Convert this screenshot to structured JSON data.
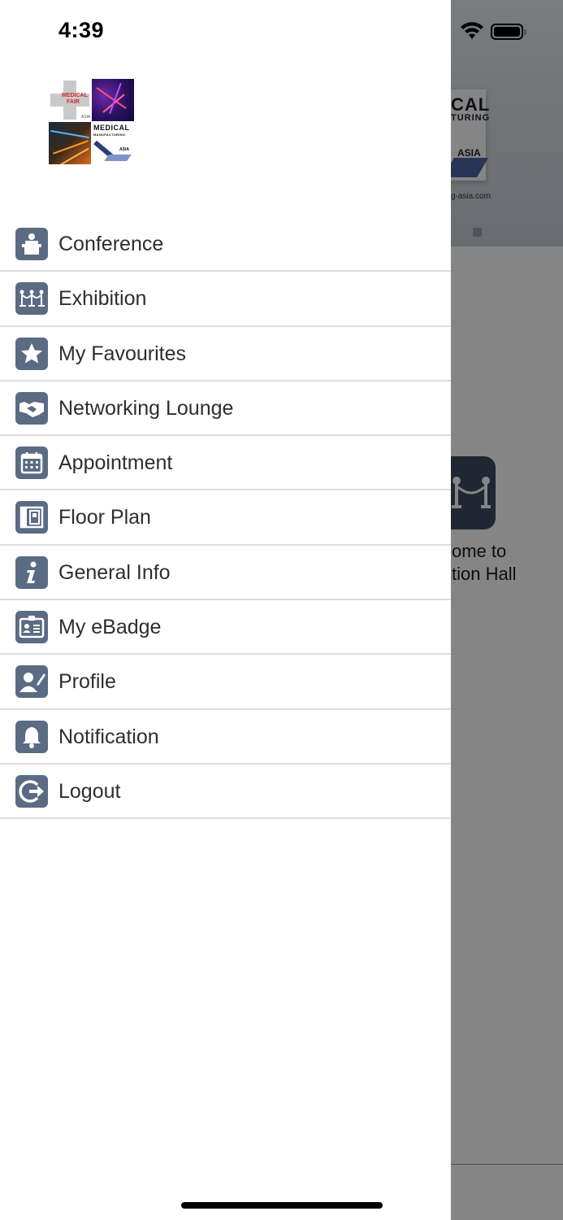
{
  "status_bar": {
    "time": "4:39"
  },
  "background": {
    "logo_line1": "CAL",
    "logo_line2": "TURING",
    "logo_asia": "ASIA",
    "url_fragment": "g-asia.com",
    "welcome_line1": "ome to",
    "welcome_line2": "tion Hall"
  },
  "drawer": {
    "logo": {
      "medical_fair_line1": "MEDICAL",
      "medical_fair_line2": "FAIR",
      "medical_fair_asia": "ASIA",
      "mma_line1": "MEDICAL",
      "mma_line2": "MANUFACTURING",
      "mma_asia": "ASIA"
    },
    "menu": [
      {
        "label": "Conference",
        "icon": "conference-icon"
      },
      {
        "label": "Exhibition",
        "icon": "exhibition-icon"
      },
      {
        "label": "My Favourites",
        "icon": "star-icon"
      },
      {
        "label": "Networking Lounge",
        "icon": "handshake-icon"
      },
      {
        "label": "Appointment",
        "icon": "calendar-icon"
      },
      {
        "label": "Floor Plan",
        "icon": "floor-plan-icon"
      },
      {
        "label": "General Info",
        "icon": "info-icon"
      },
      {
        "label": "My eBadge",
        "icon": "badge-icon"
      },
      {
        "label": "Profile",
        "icon": "profile-icon"
      },
      {
        "label": "Notification",
        "icon": "bell-icon"
      },
      {
        "label": "Logout",
        "icon": "logout-icon"
      }
    ]
  },
  "colors": {
    "icon_bg": "#5a6b83",
    "divider": "#dcdcdc",
    "text": "#2e2e2e",
    "overlay": "rgba(0,0,0,0.48)"
  }
}
